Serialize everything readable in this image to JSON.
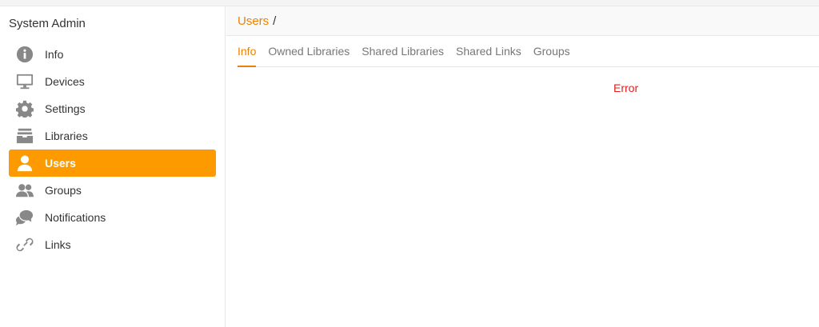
{
  "sidebar": {
    "title": "System Admin",
    "items": [
      {
        "label": "Info",
        "icon": "info-icon",
        "active": false
      },
      {
        "label": "Devices",
        "icon": "monitor-icon",
        "active": false
      },
      {
        "label": "Settings",
        "icon": "gear-icon",
        "active": false
      },
      {
        "label": "Libraries",
        "icon": "archive-icon",
        "active": false
      },
      {
        "label": "Users",
        "icon": "user-icon",
        "active": true
      },
      {
        "label": "Groups",
        "icon": "users-icon",
        "active": false
      },
      {
        "label": "Notifications",
        "icon": "chat-bubbles-icon",
        "active": false
      },
      {
        "label": "Links",
        "icon": "link-icon",
        "active": false
      }
    ]
  },
  "breadcrumb": {
    "link": "Users",
    "separator": "/"
  },
  "tabs": [
    {
      "label": "Info",
      "active": true
    },
    {
      "label": "Owned Libraries",
      "active": false
    },
    {
      "label": "Shared Libraries",
      "active": false
    },
    {
      "label": "Shared Links",
      "active": false
    },
    {
      "label": "Groups",
      "active": false
    }
  ],
  "content": {
    "error": "Error"
  },
  "colors": {
    "accent": "#eb8205",
    "active_nav_bg": "#fd9a00",
    "error": "#e02020",
    "icon_gray": "#888888"
  }
}
